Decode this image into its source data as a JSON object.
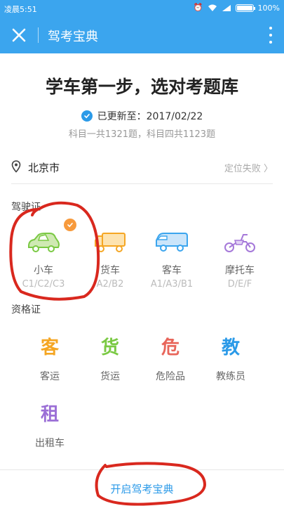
{
  "status_bar": {
    "time": "凌晨5:51",
    "battery": "100%",
    "icons": [
      "alarm-icon",
      "wifi-icon",
      "signal-icon",
      "battery-icon"
    ]
  },
  "app_bar": {
    "title": "驾考宝典"
  },
  "main": {
    "headline": "学车第一步，选对考题库",
    "updated": "已更新至：2017/02/22",
    "counts": "科目一共1321题，科目四共1123题"
  },
  "location": {
    "city": "北京市",
    "status": "定位失败"
  },
  "license": {
    "label": "驾驶证",
    "items": [
      {
        "name": "小车",
        "codes": "C1/C2/C3",
        "selected": true
      },
      {
        "name": "货车",
        "codes": "A2/B2",
        "selected": false
      },
      {
        "name": "客车",
        "codes": "A1/A3/B1",
        "selected": false
      },
      {
        "name": "摩托车",
        "codes": "D/E/F",
        "selected": false
      }
    ]
  },
  "qualification": {
    "label": "资格证",
    "items": [
      {
        "char": "客",
        "name": "客运",
        "color": "#f5a623"
      },
      {
        "char": "货",
        "name": "货运",
        "color": "#7ac943"
      },
      {
        "char": "危",
        "name": "危险品",
        "color": "#e8655a"
      },
      {
        "char": "教",
        "name": "教练员",
        "color": "#2b9ae8"
      },
      {
        "char": "租",
        "name": "出租车",
        "color": "#9b6fd6"
      }
    ]
  },
  "bottom": {
    "start_label": "开启驾考宝典"
  },
  "colors": {
    "brand": "#3ba5ee",
    "accent": "#2b9ae8",
    "selected_badge": "#f79a3c",
    "annotation": "#d9281e"
  }
}
